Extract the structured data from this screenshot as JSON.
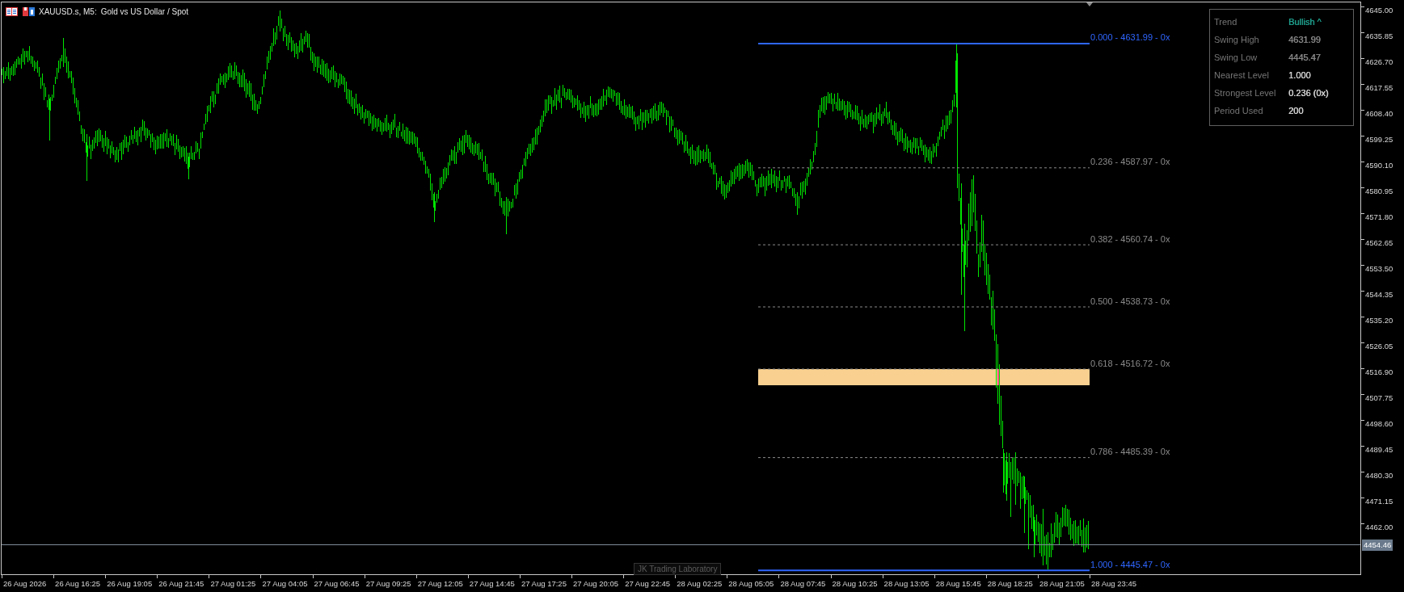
{
  "chart_window": {
    "symbol": "XAUUSD.s, M5:",
    "description": "Gold vs US Dollar / Spot"
  },
  "info_panel": {
    "rows": [
      {
        "label": "Trend",
        "value": "Bullish ^",
        "color": "#1f9e8c"
      },
      {
        "label": "Swing High",
        "value": "4631.99",
        "color": "#858585"
      },
      {
        "label": "Swing Low",
        "value": "4445.47",
        "color": "#858585"
      },
      {
        "label": "Nearest Level",
        "value": "1.000",
        "color": "#d4d4d4"
      },
      {
        "label": "Strongest Level",
        "value": "0.236 (0x)",
        "color": "#d4d4d4"
      },
      {
        "label": "Period Used",
        "value": "200",
        "color": "#d4d4d4"
      }
    ]
  },
  "fib_levels": [
    {
      "label": "0.000 - 4631.99 - 0x",
      "kind": "solid",
      "color": "#2f66ff",
      "zone": false
    },
    {
      "label": "0.236 - 4587.97 - 0x",
      "kind": "dashed",
      "color": "#8a8a8a",
      "zone": false
    },
    {
      "label": "0.382 - 4560.74 - 0x",
      "kind": "dashed",
      "color": "#8a8a8a",
      "zone": false
    },
    {
      "label": "0.500 - 4538.73 - 0x",
      "kind": "dashed",
      "color": "#8a8a8a",
      "zone": false
    },
    {
      "label": "0.618 - 4516.72 - 0x",
      "kind": "dashed",
      "color": "#8a8a8a",
      "zone": true
    },
    {
      "label": "0.786 - 4485.39 - 0x",
      "kind": "dashed",
      "color": "#8a8a8a",
      "zone": false
    },
    {
      "label": "1.000 - 4445.47 - 0x",
      "kind": "solid",
      "color": "#2f66ff",
      "zone": false
    }
  ],
  "branding_label": {
    "text": "JK Trading Laboratory"
  },
  "price_axis": {
    "labels": [
      "4645.00",
      "4635.85",
      "4626.70",
      "4617.55",
      "4608.40",
      "4599.25",
      "4590.10",
      "4580.95",
      "4571.80",
      "4562.65",
      "4553.50",
      "4544.35",
      "4535.20",
      "4526.05",
      "4516.90",
      "4507.75",
      "4498.60",
      "4489.45",
      "4480.30",
      "4471.15",
      "4462.00"
    ],
    "current_price": "4454.46"
  },
  "time_axis": {
    "labels": [
      "26 Aug 2026",
      "26 Aug 16:25",
      "26 Aug 19:05",
      "26 Aug 21:45",
      "27 Aug 01:25",
      "27 Aug 04:05",
      "27 Aug 06:45",
      "27 Aug 09:25",
      "27 Aug 12:05",
      "27 Aug 14:45",
      "27 Aug 17:25",
      "27 Aug 20:05",
      "27 Aug 22:45",
      "28 Aug 02:25",
      "28 Aug 05:05",
      "28 Aug 07:45",
      "28 Aug 10:25",
      "28 Aug 13:05",
      "28 Aug 15:45",
      "28 Aug 18:25",
      "28 Aug 21:05",
      "28 Aug 23:45"
    ]
  }
}
